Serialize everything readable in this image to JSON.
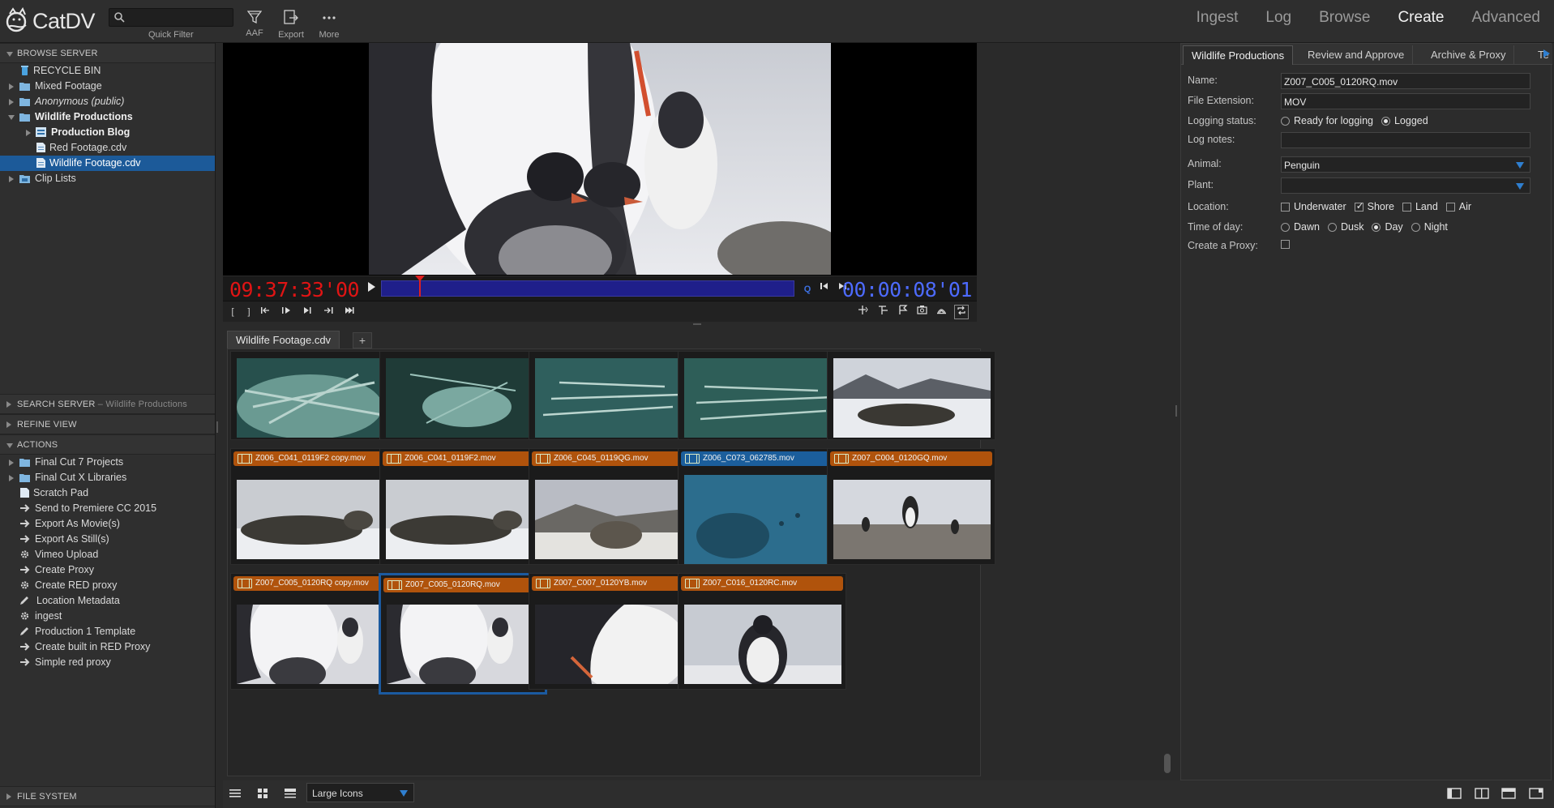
{
  "app": {
    "name": "CatDV"
  },
  "toolbar": {
    "quick_filter_label": "Quick Filter",
    "buttons": [
      {
        "label": "AAF"
      },
      {
        "label": "Export"
      },
      {
        "label": "More"
      }
    ]
  },
  "modes": [
    {
      "label": "Ingest"
    },
    {
      "label": "Log"
    },
    {
      "label": "Browse"
    },
    {
      "label": "Create"
    },
    {
      "label": "Advanced"
    }
  ],
  "sidebar": {
    "browse_server": {
      "title": "BROWSE SERVER",
      "items": [
        {
          "label": "RECYCLE BIN"
        },
        {
          "label": "Mixed Footage"
        },
        {
          "label": "Anonymous (public)"
        },
        {
          "label": "Wildlife Productions"
        },
        {
          "label": "Production Blog"
        },
        {
          "label": "Red Footage.cdv"
        },
        {
          "label": "Wildlife Footage.cdv"
        },
        {
          "label": "Clip Lists"
        }
      ]
    },
    "search_server": {
      "title": "SEARCH SERVER",
      "sub": " – Wildlife Productions"
    },
    "refine_view": {
      "title": "REFINE VIEW"
    },
    "actions": {
      "title": "ACTIONS",
      "items": [
        {
          "label": "Final Cut 7 Projects"
        },
        {
          "label": "Final Cut X Libraries"
        },
        {
          "label": "Scratch Pad"
        },
        {
          "label": "Send to Premiere CC 2015"
        },
        {
          "label": "Export As Movie(s)"
        },
        {
          "label": "Export As Still(s)"
        },
        {
          "label": "Vimeo Upload"
        },
        {
          "label": "Create Proxy"
        },
        {
          "label": "Create RED proxy"
        },
        {
          "label": "Location Metadata"
        },
        {
          "label": "ingest"
        },
        {
          "label": "Production 1 Template"
        },
        {
          "label": "Create built in RED Proxy"
        },
        {
          "label": "Simple red proxy"
        }
      ]
    },
    "file_system": {
      "title": "FILE SYSTEM"
    }
  },
  "viewer": {
    "timecode_left": "09:37:33'00",
    "timecode_right": "00:00:08'01",
    "q_label": "Q",
    "playhead_fraction": 0.09
  },
  "browser": {
    "tab_label": "Wildlife Footage.cdv",
    "add_tab": "+",
    "clips": [
      {
        "name": ""
      },
      {
        "name": ""
      },
      {
        "name": ""
      },
      {
        "name": ""
      },
      {
        "name": ""
      },
      {
        "name": "Z006_C041_0119F2 copy.mov"
      },
      {
        "name": "Z006_C041_0119F2.mov"
      },
      {
        "name": "Z006_C045_0119QG.mov"
      },
      {
        "name": "Z006_C073_062785.mov"
      },
      {
        "name": "Z007_C004_0120GQ.mov"
      },
      {
        "name": "Z007_C005_0120RQ copy.mov"
      },
      {
        "name": "Z007_C005_0120RQ.mov"
      },
      {
        "name": "Z007_C007_0120YB.mov"
      },
      {
        "name": "Z007_C016_0120RC.mov"
      }
    ],
    "view_mode": "Large Icons"
  },
  "inspector": {
    "tabs": [
      {
        "label": "Wildlife Productions"
      },
      {
        "label": "Review and Approve"
      },
      {
        "label": "Archive & Proxy"
      },
      {
        "label": "Te"
      }
    ],
    "fields": {
      "name": {
        "label": "Name:",
        "value": "Z007_C005_0120RQ.mov"
      },
      "ext": {
        "label": "File Extension:",
        "value": "MOV"
      },
      "logging": {
        "label": "Logging status:",
        "opt1": "Ready for logging",
        "opt2": "Logged"
      },
      "notes": {
        "label": "Log notes:",
        "value": ""
      },
      "animal": {
        "label": "Animal:",
        "value": "Penguin"
      },
      "plant": {
        "label": "Plant:",
        "value": ""
      },
      "location": {
        "label": "Location:",
        "opt1": "Underwater",
        "opt2": "Shore",
        "opt3": "Land",
        "opt4": "Air"
      },
      "time": {
        "label": "Time of day:",
        "opt1": "Dawn",
        "opt2": "Dusk",
        "opt3": "Day",
        "opt4": "Night"
      },
      "proxy": {
        "label": "Create a Proxy:"
      }
    }
  },
  "colors": {
    "accent": "#1c5a99",
    "clip_caption": "#b0530c",
    "timecode_in": "#e01414",
    "timecode_out": "#4d6bff"
  }
}
